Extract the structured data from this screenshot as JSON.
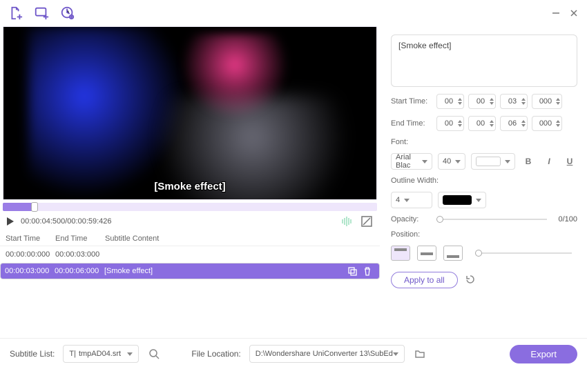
{
  "caption_overlay": "[Smoke effect]",
  "playback": {
    "current": "00:00:04:500",
    "total": "00:00:59:426"
  },
  "table": {
    "headers": {
      "start": "Start Time",
      "end": "End Time",
      "content": "Subtitle Content"
    },
    "rows": [
      {
        "start": "00:00:00:000",
        "end": "00:00:03:000",
        "content": "",
        "selected": false
      },
      {
        "start": "00:00:03:000",
        "end": "00:00:06:000",
        "content": "[Smoke effect]",
        "selected": true
      }
    ]
  },
  "editor": {
    "text": "[Smoke effect]",
    "start_label": "Start Time:",
    "end_label": "End Time:",
    "start": {
      "h": "00",
      "m": "00",
      "s": "03",
      "ms": "000"
    },
    "end": {
      "h": "00",
      "m": "00",
      "s": "06",
      "ms": "000"
    },
    "font_label": "Font:",
    "font_name": "Arial Blac",
    "font_size": "40",
    "font_color": "#ffffff",
    "outline_label": "Outline Width:",
    "outline_width": "4",
    "outline_color": "#000000",
    "opacity_label": "Opacity:",
    "opacity_value": "0/100",
    "position_label": "Position:",
    "apply_label": "Apply to all"
  },
  "footer": {
    "sub_list_label": "Subtitle List:",
    "sub_list_value": "tmpAD04.srt",
    "loc_label": "File Location:",
    "loc_value": "D:\\Wondershare UniConverter 13\\SubEd",
    "export_label": "Export"
  }
}
